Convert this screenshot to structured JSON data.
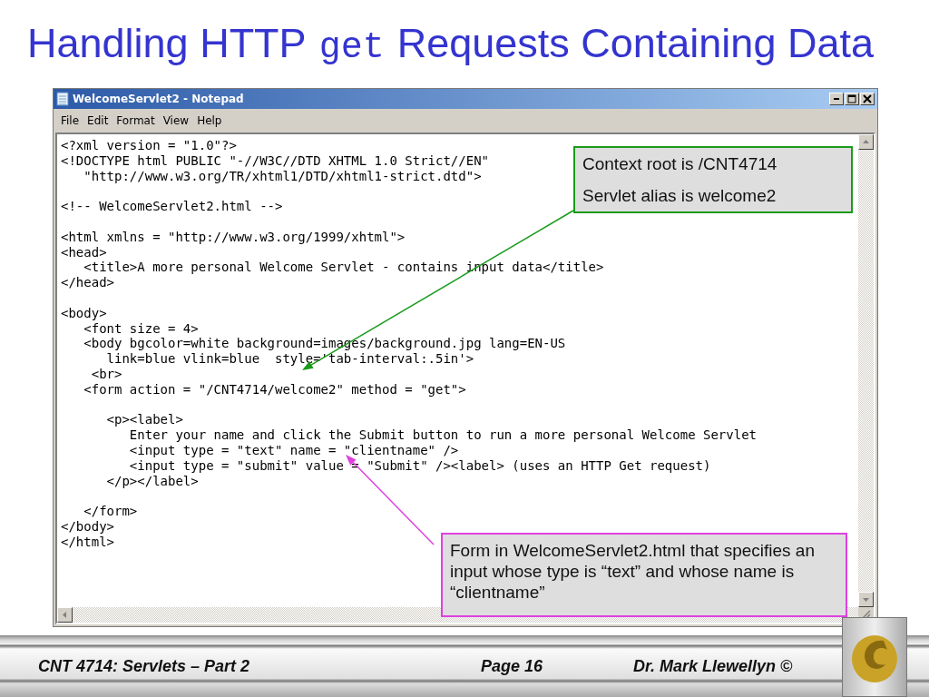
{
  "title": [
    {
      "kind": "text",
      "text": "Handling HTTP"
    },
    {
      "kind": "code",
      "text": "get"
    },
    {
      "kind": "text",
      "text": "Requests Containing Data"
    }
  ],
  "window": {
    "title": "WelcomeServlet2 - Notepad",
    "menu": [
      "File",
      "Edit",
      "Format",
      "View",
      "Help"
    ],
    "blocks": [
      [
        "<?xml version = \"1.0\"?>",
        "<!DOCTYPE html PUBLIC \"-//W3C//DTD XHTML 1.0 Strict//EN\"",
        "   \"http://www.w3.org/TR/xhtml1/DTD/xhtml1-strict.dtd\">"
      ],
      [
        "<!-- WelcomeServlet2.html -->"
      ],
      [
        "<html xmlns = \"http://www.w3.org/1999/xhtml\">",
        "<head>",
        "   <title>A more personal Welcome Servlet - contains input data</title>",
        "</head>"
      ],
      [
        "<body>",
        "   <font size = 4>",
        "   <body bgcolor=white background=images/background.jpg lang=EN-US",
        "      link=blue vlink=blue  style='tab-interval:.5in'>",
        "    <br>",
        "   <form action = \"/CNT4714/welcome2\" method = \"get\">"
      ],
      [
        "      <p><label>",
        "         Enter your name and click the Submit button to run a more personal Welcome Servlet",
        "         <input type = \"text\" name = \"clientname\" />",
        "         <input type = \"submit\" value = \"Submit\" /><label> (uses an HTTP Get request)",
        "      </p></label>"
      ],
      [
        "   </form>",
        "</body>",
        "</html>"
      ]
    ]
  },
  "callouts": [
    {
      "lines": [
        "Context root is /CNT4714",
        "Servlet alias is welcome2"
      ],
      "color": "#1a9a1a"
    },
    {
      "lines": [
        "Form in WelcomeServlet2.html that specifies an input whose type is “text” and whose name is “clientname”"
      ],
      "color": "#e040e0"
    }
  ],
  "footer": {
    "course": "CNT 4714: Servlets – Part 2",
    "page": "Page 16",
    "author": "Dr. Mark Llewellyn ©"
  }
}
